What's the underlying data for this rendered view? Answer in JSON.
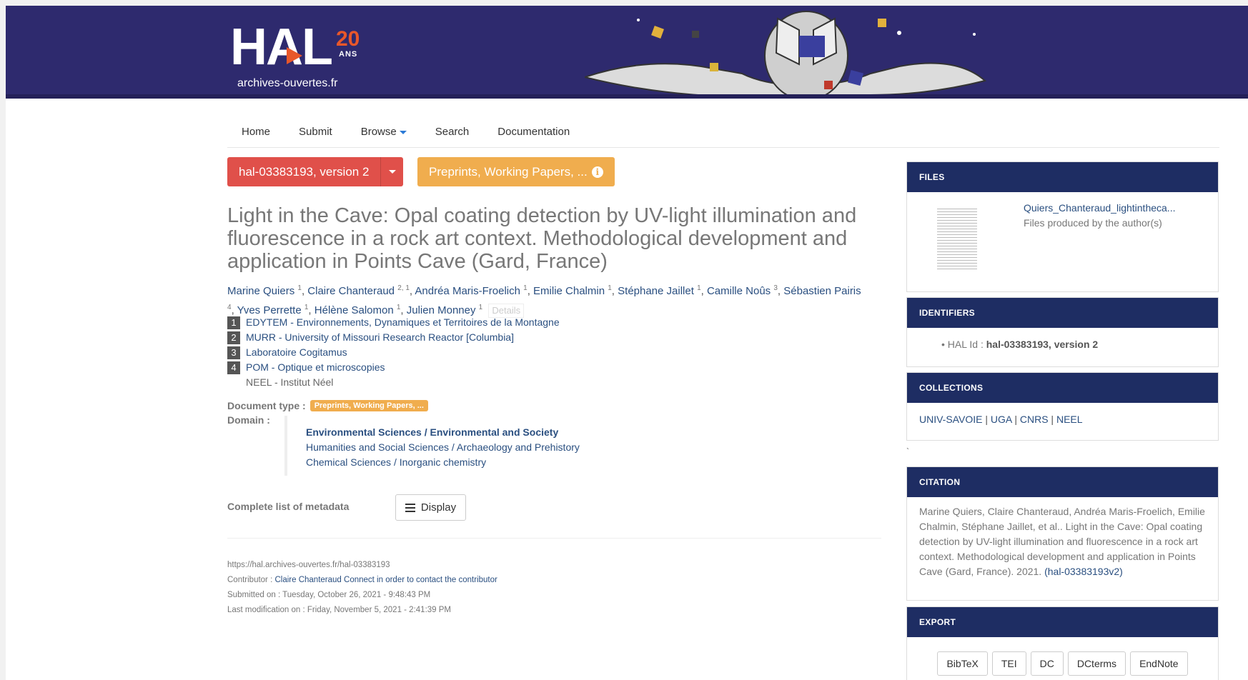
{
  "logo": {
    "hal": "HAL",
    "anniv": "20",
    "anniv_sub": "ANS",
    "site": "archives-ouvertes.fr"
  },
  "nav": {
    "home": "Home",
    "submit": "Submit",
    "browse": "Browse",
    "search": "Search",
    "documentation": "Documentation"
  },
  "record": {
    "version_label": "hal-03383193, version 2",
    "doctype_button": "Preprints, Working Papers, ...",
    "title": "Light in the Cave: Opal coating detection by UV-light illumination and fluorescence in a rock art context. Methodological development and application in Points Cave (Gard, France)",
    "authors": [
      {
        "name": "Marine Quiers",
        "aff": "1"
      },
      {
        "name": "Claire Chanteraud",
        "aff": "2, 1"
      },
      {
        "name": "Andréa Maris-Froelich",
        "aff": "1"
      },
      {
        "name": "Emilie Chalmin",
        "aff": "1"
      },
      {
        "name": "Stéphane Jaillet",
        "aff": "1"
      },
      {
        "name": "Camille Noûs",
        "aff": "3"
      },
      {
        "name": "Sébastien Pairis",
        "aff": "4"
      },
      {
        "name": "Yves Perrette",
        "aff": "1"
      },
      {
        "name": "Hélène Salomon",
        "aff": "1"
      },
      {
        "name": "Julien Monney",
        "aff": "1"
      }
    ],
    "details_label": "Details",
    "affiliations": [
      {
        "num": "1",
        "text": "EDYTEM - Environnements, Dynamiques et Territoires de la Montagne"
      },
      {
        "num": "2",
        "text": "MURR - University of Missouri Research Reactor [Columbia]"
      },
      {
        "num": "3",
        "text": "Laboratoire Cogitamus"
      },
      {
        "num": "4",
        "text": "POM - Optique et microscopies"
      },
      {
        "num": "",
        "text": "NEEL - Institut Néel"
      }
    ],
    "doctype_label": "Document type :",
    "doctype_badge": "Preprints, Working Papers, ...",
    "domain_label": "Domain :",
    "domains": [
      {
        "a": "Environmental Sciences",
        "b": "Environmental and Society"
      },
      {
        "a": "Humanities and Social Sciences",
        "b": "Archaeology and Prehistory"
      },
      {
        "a": "Chemical Sciences",
        "b": "Inorganic chemistry"
      }
    ],
    "domain_sep": " / ",
    "complete_label": "Complete list of metadata",
    "display_label": "Display",
    "url": "https://hal.archives-ouvertes.fr/hal-03383193",
    "contributor_label": "Contributor : ",
    "contributor": "Claire Chanteraud",
    "contact": "Connect in order to contact the contributor",
    "submitted": "Submitted on : Tuesday, October 26, 2021 - 9:48:43 PM",
    "modified": "Last modification on : Friday, November 5, 2021 - 2:41:39 PM"
  },
  "sidebar": {
    "files": {
      "head": "FILES",
      "name": "Quiers_Chanteraud_lightintheca...",
      "desc": "Files produced by the author(s)"
    },
    "identifiers": {
      "head": "IDENTIFIERS",
      "label": "HAL Id : ",
      "value": "hal-03383193, version 2"
    },
    "collections": {
      "head": "COLLECTIONS",
      "items": [
        "UNIV-SAVOIE",
        "UGA",
        "CNRS",
        "NEEL"
      ]
    },
    "citation": {
      "head": "CITATION",
      "text": "Marine Quiers, Claire Chanteraud, Andréa Maris-Froelich, Emilie Chalmin, Stéphane Jaillet, et al.. Light in the Cave: Opal coating detection by UV-light illumination and fluorescence in a rock art context. Methodological development and application in Points Cave (Gard, France). 2021. ",
      "link": "(hal-03383193v2)"
    },
    "export": {
      "head": "EXPORT",
      "buttons": [
        "BibTeX",
        "TEI",
        "DC",
        "DCterms",
        "EndNote"
      ]
    }
  },
  "colors": {
    "banner": "#2e2a6e",
    "accent": "#e8572a",
    "version": "#e0504a",
    "doctype": "#f0ad4e",
    "panel_head": "#1e2d63",
    "link": "#2a4f80"
  }
}
